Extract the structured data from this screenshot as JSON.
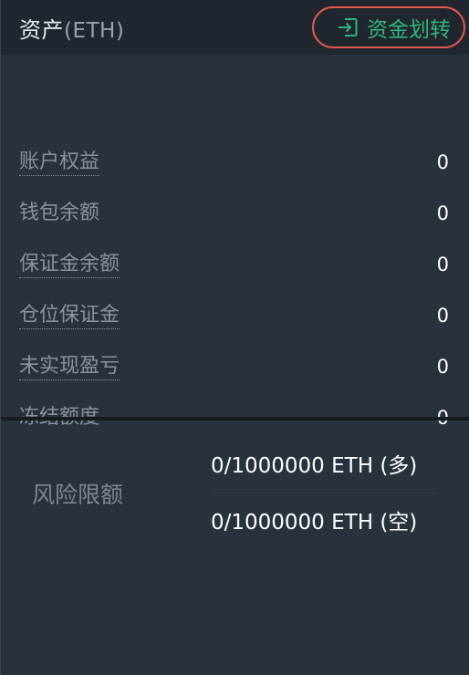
{
  "header": {
    "title": "资产",
    "unit": "(ETH)",
    "transfer_label": "资金划转"
  },
  "assets": [
    {
      "label": "账户权益",
      "value": "0"
    },
    {
      "label": "钱包余额",
      "value": "0"
    },
    {
      "label": "保证金余额",
      "value": "0"
    },
    {
      "label": "仓位保证金",
      "value": "0"
    },
    {
      "label": "未实现盈亏",
      "value": "0"
    },
    {
      "label": "冻结额度",
      "value": "0"
    }
  ],
  "risk_limit": {
    "label": "风险限额",
    "long": "0/1000000 ETH (多)",
    "short": "0/1000000 ETH (空)"
  },
  "colors": {
    "accent_green": "#2fb67c",
    "highlight_red": "#e05a4f",
    "panel_bg": "#28323d",
    "header_bg": "#1f262e"
  },
  "icons": {
    "transfer": "login-arrow-icon"
  }
}
